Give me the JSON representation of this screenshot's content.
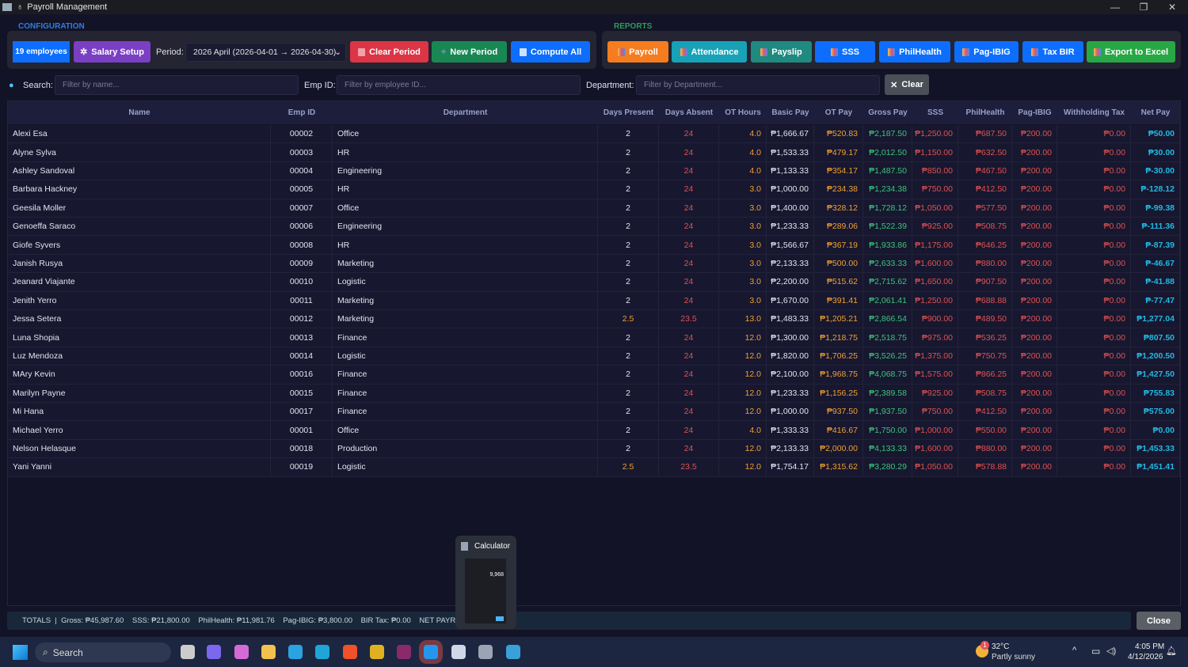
{
  "window": {
    "title": "Payroll Management",
    "minimize": "—",
    "maximize": "❐",
    "close": "✕"
  },
  "config": {
    "label": "CONFIGURATION",
    "employees_badge": "19 employees",
    "salary_setup": "Salary Setup",
    "period_label": "Period:",
    "period_value": "2026 April  (2026-04-01 → 2026-04-30)",
    "clear_period": "Clear Period",
    "new_period": "New Period",
    "compute_all": "Compute All"
  },
  "reports": {
    "label": "REPORTS",
    "buttons": [
      {
        "label": "Payroll",
        "color": "#f57c1f"
      },
      {
        "label": "Attendance",
        "color": "#17a2b8"
      },
      {
        "label": "Payslip",
        "color": "#1f8a80"
      },
      {
        "label": "SSS",
        "color": "#0d6efd"
      },
      {
        "label": "PhilHealth",
        "color": "#0d6efd"
      },
      {
        "label": "Pag-IBIG",
        "color": "#0d6efd"
      },
      {
        "label": "Tax BIR",
        "color": "#0d6efd"
      },
      {
        "label": "Export to Excel",
        "color": "#28a745"
      }
    ]
  },
  "filters": {
    "search_label": "Search:",
    "search_placeholder": "Filter by name...",
    "empid_label": "Emp ID:",
    "empid_placeholder": "Filter by employee ID...",
    "dept_label": "Department:",
    "dept_placeholder": "Filter by Department...",
    "clear": "Clear"
  },
  "table": {
    "columns": [
      "Name",
      "Emp ID",
      "Department",
      "Days Present",
      "Days Absent",
      "OT Hours",
      "Basic Pay",
      "OT Pay",
      "Gross Pay",
      "SSS",
      "PhilHealth",
      "Pag-IBIG",
      "Withholding Tax",
      "Net Pay"
    ],
    "rows": [
      [
        "Alexi Esa",
        "00002",
        "Office",
        "2",
        "24",
        "4.0",
        "₱1,666.67",
        "₱520.83",
        "₱2,187.50",
        "₱1,250.00",
        "₱687.50",
        "₱200.00",
        "₱0.00",
        "₱50.00"
      ],
      [
        "Alyne Sylva",
        "00003",
        "HR",
        "2",
        "24",
        "4.0",
        "₱1,533.33",
        "₱479.17",
        "₱2,012.50",
        "₱1,150.00",
        "₱632.50",
        "₱200.00",
        "₱0.00",
        "₱30.00"
      ],
      [
        "Ashley Sandoval",
        "00004",
        "Engineering",
        "2",
        "24",
        "4.0",
        "₱1,133.33",
        "₱354.17",
        "₱1,487.50",
        "₱850.00",
        "₱467.50",
        "₱200.00",
        "₱0.00",
        "₱-30.00"
      ],
      [
        "Barbara Hackney",
        "00005",
        "HR",
        "2",
        "24",
        "3.0",
        "₱1,000.00",
        "₱234.38",
        "₱1,234.38",
        "₱750.00",
        "₱412.50",
        "₱200.00",
        "₱0.00",
        "₱-128.12"
      ],
      [
        "Geesila Moller",
        "00007",
        "Office",
        "2",
        "24",
        "3.0",
        "₱1,400.00",
        "₱328.12",
        "₱1,728.12",
        "₱1,050.00",
        "₱577.50",
        "₱200.00",
        "₱0.00",
        "₱-99.38"
      ],
      [
        "Genoeffa Saraco",
        "00006",
        "Engineering",
        "2",
        "24",
        "3.0",
        "₱1,233.33",
        "₱289.06",
        "₱1,522.39",
        "₱925.00",
        "₱508.75",
        "₱200.00",
        "₱0.00",
        "₱-111.36"
      ],
      [
        "Giofe Syvers",
        "00008",
        "HR",
        "2",
        "24",
        "3.0",
        "₱1,566.67",
        "₱367.19",
        "₱1,933.86",
        "₱1,175.00",
        "₱646.25",
        "₱200.00",
        "₱0.00",
        "₱-87.39"
      ],
      [
        "Janish Rusya",
        "00009",
        "Marketing",
        "2",
        "24",
        "3.0",
        "₱2,133.33",
        "₱500.00",
        "₱2,633.33",
        "₱1,600.00",
        "₱880.00",
        "₱200.00",
        "₱0.00",
        "₱-46.67"
      ],
      [
        "Jeanard Viajante",
        "00010",
        "Logistic",
        "2",
        "24",
        "3.0",
        "₱2,200.00",
        "₱515.62",
        "₱2,715.62",
        "₱1,650.00",
        "₱907.50",
        "₱200.00",
        "₱0.00",
        "₱-41.88"
      ],
      [
        "Jenith Yerro",
        "00011",
        "Marketing",
        "2",
        "24",
        "3.0",
        "₱1,670.00",
        "₱391.41",
        "₱2,061.41",
        "₱1,250.00",
        "₱688.88",
        "₱200.00",
        "₱0.00",
        "₱-77.47"
      ],
      [
        "Jessa Setera",
        "00012",
        "Marketing",
        "2.5",
        "23.5",
        "13.0",
        "₱1,483.33",
        "₱1,205.21",
        "₱2,866.54",
        "₱900.00",
        "₱489.50",
        "₱200.00",
        "₱0.00",
        "₱1,277.04"
      ],
      [
        "Luna Shopia",
        "00013",
        "Finance",
        "2",
        "24",
        "12.0",
        "₱1,300.00",
        "₱1,218.75",
        "₱2,518.75",
        "₱975.00",
        "₱536.25",
        "₱200.00",
        "₱0.00",
        "₱807.50"
      ],
      [
        "Luz Mendoza",
        "00014",
        "Logistic",
        "2",
        "24",
        "12.0",
        "₱1,820.00",
        "₱1,706.25",
        "₱3,526.25",
        "₱1,375.00",
        "₱750.75",
        "₱200.00",
        "₱0.00",
        "₱1,200.50"
      ],
      [
        "MAry Kevin",
        "00016",
        "Finance",
        "2",
        "24",
        "12.0",
        "₱2,100.00",
        "₱1,968.75",
        "₱4,068.75",
        "₱1,575.00",
        "₱866.25",
        "₱200.00",
        "₱0.00",
        "₱1,427.50"
      ],
      [
        "Marilyn Payne",
        "00015",
        "Finance",
        "2",
        "24",
        "12.0",
        "₱1,233.33",
        "₱1,156.25",
        "₱2,389.58",
        "₱925.00",
        "₱508.75",
        "₱200.00",
        "₱0.00",
        "₱755.83"
      ],
      [
        "Mi Hana",
        "00017",
        "Finance",
        "2",
        "24",
        "12.0",
        "₱1,000.00",
        "₱937.50",
        "₱1,937.50",
        "₱750.00",
        "₱412.50",
        "₱200.00",
        "₱0.00",
        "₱575.00"
      ],
      [
        "Michael Yerro",
        "00001",
        "Office",
        "2",
        "24",
        "4.0",
        "₱1,333.33",
        "₱416.67",
        "₱1,750.00",
        "₱1,000.00",
        "₱550.00",
        "₱200.00",
        "₱0.00",
        "₱0.00"
      ],
      [
        "Nelson Helasque",
        "00018",
        "Production",
        "2",
        "24",
        "12.0",
        "₱2,133.33",
        "₱2,000.00",
        "₱4,133.33",
        "₱1,600.00",
        "₱880.00",
        "₱200.00",
        "₱0.00",
        "₱1,453.33"
      ],
      [
        "Yani Yanni",
        "00019",
        "Logistic",
        "2.5",
        "23.5",
        "12.0",
        "₱1,754.17",
        "₱1,315.62",
        "₱3,280.29",
        "₱1,050.00",
        "₱578.88",
        "₱200.00",
        "₱0.00",
        "₱1,451.41"
      ]
    ]
  },
  "totals": "TOTALS  |  Gross: ₱45,987.60    SSS: ₱21,800.00    PhilHealth: ₱11,981.76    Pag-IBIG: ₱3,800.00    BIR Tax: ₱0.00    NET PAYROLL: ₱8,405.84",
  "close_button": "Close",
  "calculator_preview": {
    "title": "Calculator",
    "display": "9,968"
  },
  "taskbar": {
    "search": "Search",
    "weather_temp": "32°C",
    "weather_desc": "Partly sunny",
    "weather_badge": "1",
    "time": "4:05 PM",
    "date": "4/12/2026"
  }
}
